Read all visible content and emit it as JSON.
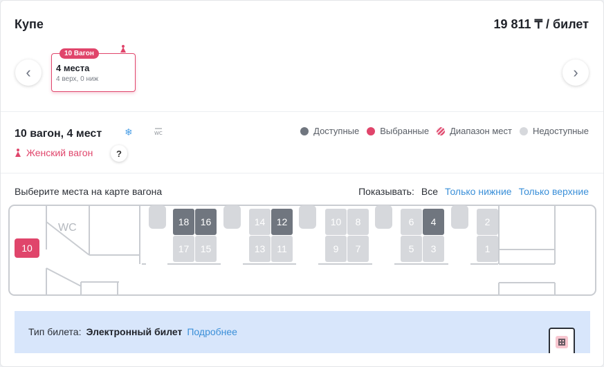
{
  "header": {
    "title": "Купе",
    "price": "19 811 ₸  / билет"
  },
  "carousel": {
    "wagon_badge": "10 Вагон",
    "seats_count": "4 места",
    "seats_detail": "4 верх, 0 ниж",
    "prev_icon": "chevron-left-icon",
    "next_icon": "chevron-right-icon"
  },
  "wagon": {
    "title": "10 вагон, 4 мест",
    "ac_icon": "snowflake-icon",
    "wc_label": "WC",
    "female_label": "Женский вагон",
    "help_label": "?"
  },
  "legend": [
    {
      "label": "Доступные",
      "color": "#70767f"
    },
    {
      "label": "Выбранные",
      "color": "#e0456b"
    },
    {
      "label": "Диапазон мест",
      "color": "#e7a3b5"
    },
    {
      "label": "Недоступные",
      "color": "#d6d8dc"
    }
  ],
  "map": {
    "prompt": "Выберите места на карте вагона",
    "show_label": "Показывать:",
    "show_all": "Все",
    "show_lower": "Только нижние",
    "show_upper": "Только верхние",
    "wc_text": "WC",
    "wagon_number": "10",
    "seats": [
      {
        "n": "18",
        "status": "available"
      },
      {
        "n": "17",
        "status": "unavailable"
      },
      {
        "n": "16",
        "status": "available"
      },
      {
        "n": "15",
        "status": "unavailable"
      },
      {
        "n": "14",
        "status": "unavailable"
      },
      {
        "n": "13",
        "status": "unavailable"
      },
      {
        "n": "12",
        "status": "available"
      },
      {
        "n": "11",
        "status": "unavailable"
      },
      {
        "n": "10",
        "status": "unavailable"
      },
      {
        "n": "9",
        "status": "unavailable"
      },
      {
        "n": "8",
        "status": "unavailable"
      },
      {
        "n": "7",
        "status": "unavailable"
      },
      {
        "n": "6",
        "status": "unavailable"
      },
      {
        "n": "5",
        "status": "unavailable"
      },
      {
        "n": "4",
        "status": "available"
      },
      {
        "n": "3",
        "status": "unavailable"
      },
      {
        "n": "2",
        "status": "unavailable"
      },
      {
        "n": "1",
        "status": "unavailable"
      }
    ]
  },
  "ticket": {
    "type_label": "Тип билета:",
    "type_value": "Электронный билет",
    "more_link": "Подробнее"
  }
}
